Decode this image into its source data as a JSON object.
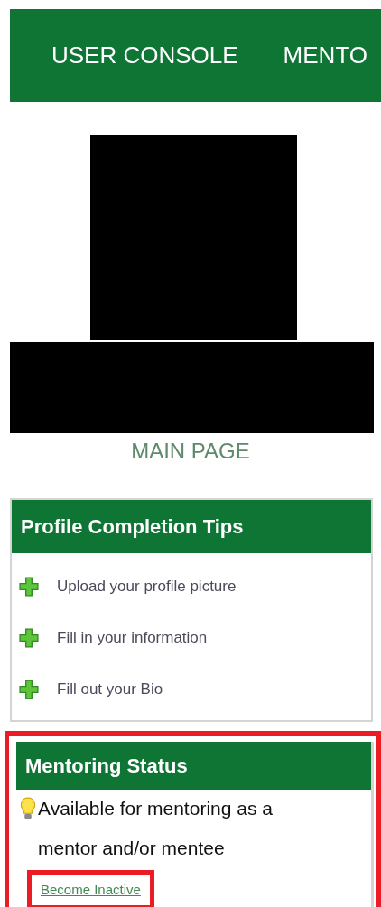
{
  "nav": {
    "items": [
      {
        "label": "USER CONSOLE"
      },
      {
        "label": "MENTO"
      }
    ]
  },
  "main_link": "MAIN PAGE",
  "tips_card": {
    "title": "Profile Completion Tips",
    "items": [
      {
        "label": "Upload your profile picture"
      },
      {
        "label": "Fill in your information"
      },
      {
        "label": "Fill out your Bio"
      }
    ]
  },
  "status_card": {
    "title": "Mentoring Status",
    "highlighted": true,
    "text": "Available for mentoring as a mentor and/or mentee",
    "link": {
      "label": "Become Inactive",
      "highlighted": true
    }
  }
}
